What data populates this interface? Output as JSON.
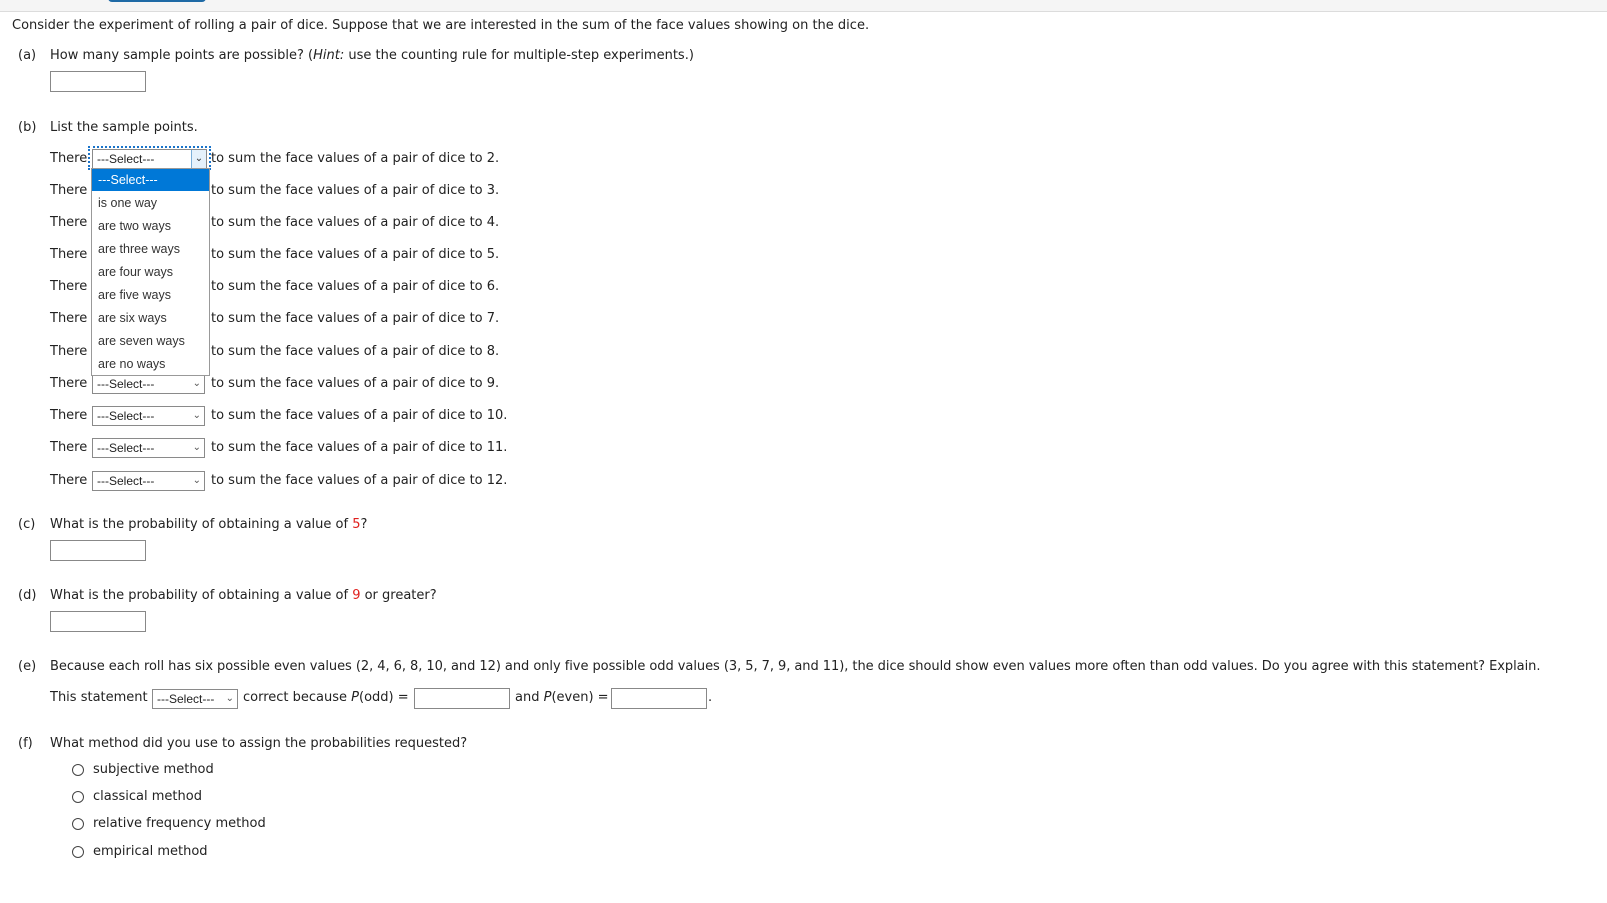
{
  "intro": "Consider the experiment of rolling a pair of dice. Suppose that we are interested in the sum of the face values showing on the dice.",
  "part_a": {
    "label": "(a)",
    "question_prefix": "How many sample points are possible? (",
    "hint_label": "Hint:",
    "question_suffix": " use the counting rule for multiple-step experiments.)",
    "answer_value": ""
  },
  "part_b": {
    "label": "(b)",
    "question": "List the sample points.",
    "row_prefix": "There",
    "rows": [
      {
        "selected": "---Select---",
        "suffix": "to sum the face values of a pair of dice to 2."
      },
      {
        "selected": "---Select---",
        "suffix": "to sum the face values of a pair of dice to 3."
      },
      {
        "selected": "---Select---",
        "suffix": "to sum the face values of a pair of dice to 4."
      },
      {
        "selected": "---Select---",
        "suffix": "to sum the face values of a pair of dice to 5."
      },
      {
        "selected": "---Select---",
        "suffix": "to sum the face values of a pair of dice to 6."
      },
      {
        "selected": "---Select---",
        "suffix": "to sum the face values of a pair of dice to 7."
      },
      {
        "selected": "---Select---",
        "suffix": "to sum the face values of a pair of dice to 8."
      },
      {
        "selected": "---Select---",
        "suffix": "to sum the face values of a pair of dice to 9."
      },
      {
        "selected": "---Select---",
        "suffix": "to sum the face values of a pair of dice to 10."
      },
      {
        "selected": "---Select---",
        "suffix": "to sum the face values of a pair of dice to 11."
      },
      {
        "selected": "---Select---",
        "suffix": "to sum the face values of a pair of dice to 12."
      }
    ],
    "dropdown_options": [
      "---Select---",
      "is one way",
      "are two ways",
      "are three ways",
      "are four ways",
      "are five ways",
      "are six ways",
      "are seven ways",
      "are no ways"
    ],
    "dropdown_highlighted": "---Select---"
  },
  "part_c": {
    "label": "(c)",
    "question_prefix": "What is the probability of obtaining a value of ",
    "value": "5",
    "question_suffix": "?",
    "answer_value": ""
  },
  "part_d": {
    "label": "(d)",
    "question_prefix": "What is the probability of obtaining a value of ",
    "value": "9",
    "question_suffix": " or greater?",
    "answer_value": ""
  },
  "part_e": {
    "label": "(e)",
    "question": "Because each roll has six possible even values (2, 4, 6, 8, 10, and 12) and only five possible odd values (3, 5, 7, 9, and 11), the dice should show even values more often than odd values. Do you agree with this statement? Explain.",
    "statement_prefix": "This statement",
    "select_value": "---Select---",
    "middle_text": "correct because ",
    "p_odd_label": "P",
    "p_odd_arg": "(odd) =",
    "and_text": "and ",
    "p_even_label": "P",
    "p_even_arg": "(even) =",
    "period": ".",
    "p_odd_value": "",
    "p_even_value": ""
  },
  "part_f": {
    "label": "(f)",
    "question": "What method did you use to assign the probabilities requested?",
    "options": [
      "subjective method",
      "classical method",
      "relative frequency method",
      "empirical method"
    ]
  },
  "colors": {
    "highlight": "#0078d7",
    "focus_ring": "#1a73c9",
    "accent_value": "#e0201e"
  }
}
